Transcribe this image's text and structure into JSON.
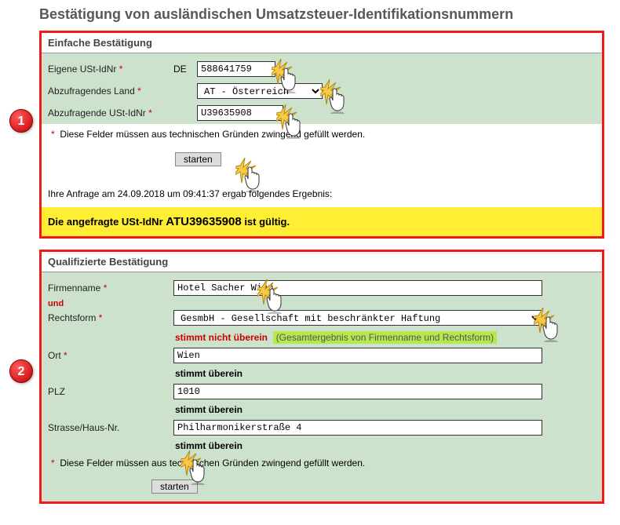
{
  "title": "Bestätigung von ausländischen Umsatzsteuer-Identifikationsnummern",
  "section1": {
    "header": "Einfache Bestätigung",
    "own_label": "Eigene USt-IdNr",
    "own_prefix": "DE",
    "own_value": "588641759",
    "country_label": "Abzufragendes Land",
    "country_value": "AT - Österreich",
    "foreign_label": "Abzufragende USt-IdNr",
    "foreign_value": "U39635908",
    "note_star": "*",
    "note_text": "Diese Felder müssen aus technischen Gründen zwingend gefüllt werden.",
    "start": "starten",
    "query_line": "Ihre Anfrage am 24.09.2018 um 09:41:37 ergab folgendes Ergebnis:",
    "result_pre": "Die angefragte USt-IdNr ",
    "result_id": "ATU39635908",
    "result_post": " ist gültig."
  },
  "badge1": "1",
  "section2": {
    "header": "Qualifizierte Bestätigung",
    "firm_label": "Firmenname",
    "firm_value": "Hotel Sacher Wien",
    "und": "und",
    "legal_label": "Rechtsform",
    "legal_value": "GesmbH         - Gesellschaft mit beschränkter Haftung",
    "match_firm_legal": "stimmt nicht überein",
    "match_firm_legal_ctx": "(Gesamtergebnis von Firmenname und Rechtsform)",
    "city_label": "Ort",
    "city_value": "Wien",
    "match_city": "stimmt überein",
    "zip_label": "PLZ",
    "zip_value": "1010",
    "match_zip": "stimmt überein",
    "street_label": "Strasse/Haus-Nr.",
    "street_value": "Philharmonikerstraße 4",
    "match_street": "stimmt überein",
    "note_star": "*",
    "note_text": "Diese Felder müssen aus technischen Gründen zwingend gefüllt werden.",
    "start": "starten"
  },
  "badge2": "2"
}
